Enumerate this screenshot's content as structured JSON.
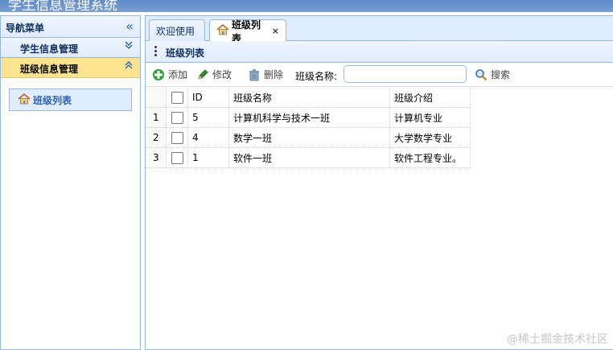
{
  "app": {
    "title": "学生信息管理系统"
  },
  "nav": {
    "title": "导航菜单",
    "groups": [
      {
        "label": "学生信息管理",
        "state": "collapsed"
      },
      {
        "label": "班级信息管理",
        "state": "expanded",
        "items": [
          {
            "label": "班级列表",
            "icon": "house-icon"
          }
        ]
      }
    ]
  },
  "tabs": [
    {
      "label": "欢迎使用"
    },
    {
      "label": "班级列表",
      "icon": "house-icon",
      "closable": "×"
    }
  ],
  "panel": {
    "title": "班级列表"
  },
  "toolbar": {
    "add_label": "添加",
    "edit_label": "修改",
    "delete_label": "删除",
    "search_field_label": "班级名称:",
    "search_value": "",
    "search_label": "搜索"
  },
  "grid": {
    "columns": [
      "ID",
      "班级名称",
      "班级介绍"
    ],
    "rows": [
      {
        "num": "1",
        "id": "5",
        "name": "计算机科学与技术一班",
        "intro": "计算机专业"
      },
      {
        "num": "2",
        "id": "4",
        "name": "数学一班",
        "intro": "大学数学专业"
      },
      {
        "num": "3",
        "id": "1",
        "name": "软件一班",
        "intro": "软件工程专业。"
      }
    ]
  },
  "watermark": "@稀土掘金技术社区",
  "colors": {
    "border": "#95b8e7",
    "header_bg": "#e0ecff",
    "active_group": "#fbe48d",
    "title_text": "#0e2d5f"
  }
}
